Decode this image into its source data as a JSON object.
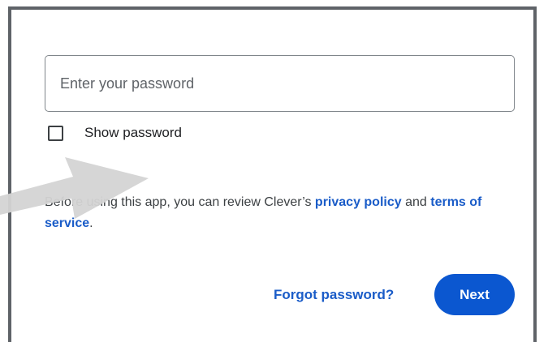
{
  "login": {
    "password_placeholder": "Enter your password",
    "show_password_label": "Show password",
    "show_password_checked": false,
    "review_prefix": "Before using this app, you can review Clever’s ",
    "privacy_policy_link": "privacy policy",
    "review_and": " and ",
    "terms_link": "terms of service",
    "review_suffix": ".",
    "forgot_password_link": "Forgot password?",
    "next_button_label": "Next"
  },
  "colors": {
    "link": "#1a5cc8",
    "primary_button": "#0b57d0",
    "frame_border": "#5f6368",
    "overlay_arrow": "#d4d4d4"
  },
  "overlay": {
    "icon": "pointer-arrow-icon"
  }
}
